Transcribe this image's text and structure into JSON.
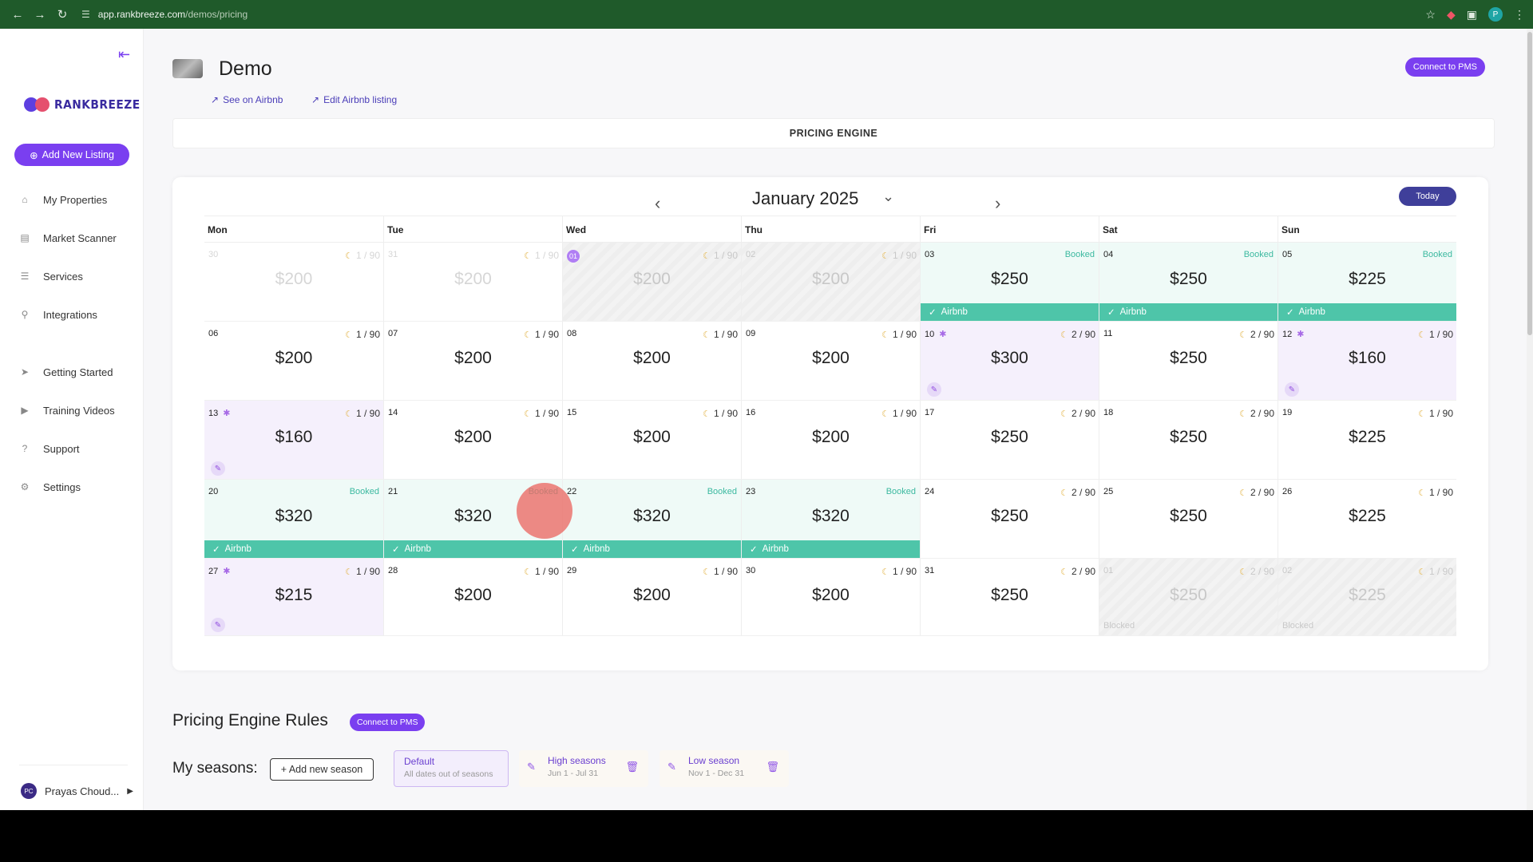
{
  "browser": {
    "url_domain": "app.rankbreeze.com",
    "url_path": "/demos/pricing"
  },
  "sidebar": {
    "brand": "RANKBREEZE",
    "add_listing": "Add New Listing",
    "items": [
      {
        "label": "My Properties",
        "icon": "home-icon"
      },
      {
        "label": "Market Scanner",
        "icon": "map-icon"
      },
      {
        "label": "Services",
        "icon": "list-icon"
      },
      {
        "label": "Integrations",
        "icon": "plug-icon"
      },
      {
        "label": "Getting Started",
        "icon": "rocket-icon"
      },
      {
        "label": "Training Videos",
        "icon": "video-icon"
      },
      {
        "label": "Support",
        "icon": "help-icon"
      },
      {
        "label": "Settings",
        "icon": "gear-icon"
      }
    ],
    "user": {
      "initials": "PC",
      "name": "Prayas Choud..."
    }
  },
  "listing": {
    "title": "Demo",
    "see_on_airbnb": "See on Airbnb",
    "edit_listing": "Edit Airbnb listing",
    "connect_pms": "Connect to PMS"
  },
  "engine_tab": "PRICING ENGINE",
  "calendar": {
    "month": "January 2025",
    "today": "Today",
    "days_of_week": [
      "Mon",
      "Tue",
      "Wed",
      "Thu",
      "Fri",
      "Sat",
      "Sun"
    ],
    "booked_label": "Booked",
    "airbnb_label": "Airbnb",
    "blocked_label": "Blocked",
    "weeks": [
      [
        {
          "day": "30",
          "nights": "1 / 90",
          "price": "$200",
          "style": "outside"
        },
        {
          "day": "31",
          "nights": "1 / 90",
          "price": "$200",
          "style": "outside"
        },
        {
          "day": "01",
          "nights": "1 / 90",
          "price": "$200",
          "style": "faded",
          "today": true
        },
        {
          "day": "02",
          "nights": "1 / 90",
          "price": "$200",
          "style": "faded"
        },
        {
          "day": "03",
          "price": "$250",
          "style": "booked",
          "booked": true,
          "airbnb": true
        },
        {
          "day": "04",
          "price": "$250",
          "style": "booked",
          "booked": true,
          "airbnb": true
        },
        {
          "day": "05",
          "price": "$225",
          "style": "booked",
          "booked": true,
          "airbnb": true
        }
      ],
      [
        {
          "day": "06",
          "nights": "1 / 90",
          "price": "$200"
        },
        {
          "day": "07",
          "nights": "1 / 90",
          "price": "$200"
        },
        {
          "day": "08",
          "nights": "1 / 90",
          "price": "$200"
        },
        {
          "day": "09",
          "nights": "1 / 90",
          "price": "$200"
        },
        {
          "day": "10",
          "nights": "2 / 90",
          "price": "$300",
          "style": "purple",
          "sparkle": true,
          "pin": true
        },
        {
          "day": "11",
          "nights": "2 / 90",
          "price": "$250"
        },
        {
          "day": "12",
          "nights": "1 / 90",
          "price": "$160",
          "style": "purple",
          "sparkle": true,
          "pin": true
        }
      ],
      [
        {
          "day": "13",
          "nights": "1 / 90",
          "price": "$160",
          "style": "purple",
          "sparkle": true,
          "pin": true
        },
        {
          "day": "14",
          "nights": "1 / 90",
          "price": "$200"
        },
        {
          "day": "15",
          "nights": "1 / 90",
          "price": "$200"
        },
        {
          "day": "16",
          "nights": "1 / 90",
          "price": "$200"
        },
        {
          "day": "17",
          "nights": "2 / 90",
          "price": "$250"
        },
        {
          "day": "18",
          "nights": "2 / 90",
          "price": "$250"
        },
        {
          "day": "19",
          "nights": "1 / 90",
          "price": "$225"
        }
      ],
      [
        {
          "day": "20",
          "price": "$320",
          "style": "booked",
          "booked": true,
          "airbnb": true
        },
        {
          "day": "21",
          "price": "$320",
          "style": "booked",
          "booked": true,
          "airbnb": true
        },
        {
          "day": "22",
          "price": "$320",
          "style": "booked",
          "booked": true,
          "airbnb": true
        },
        {
          "day": "23",
          "price": "$320",
          "style": "booked",
          "booked": true,
          "airbnb": true
        },
        {
          "day": "24",
          "nights": "2 / 90",
          "price": "$250"
        },
        {
          "day": "25",
          "nights": "2 / 90",
          "price": "$250"
        },
        {
          "day": "26",
          "nights": "1 / 90",
          "price": "$225"
        }
      ],
      [
        {
          "day": "27",
          "nights": "1 / 90",
          "price": "$215",
          "style": "purple",
          "sparkle": true,
          "pin": true
        },
        {
          "day": "28",
          "nights": "1 / 90",
          "price": "$200"
        },
        {
          "day": "29",
          "nights": "1 / 90",
          "price": "$200"
        },
        {
          "day": "30",
          "nights": "1 / 90",
          "price": "$200"
        },
        {
          "day": "31",
          "nights": "2 / 90",
          "price": "$250"
        },
        {
          "day": "01",
          "nights": "2 / 90",
          "price": "$250",
          "style": "faded",
          "blocked": true
        },
        {
          "day": "02",
          "nights": "1 / 90",
          "price": "$225",
          "style": "faded",
          "blocked": true
        }
      ]
    ]
  },
  "rules": {
    "title": "Pricing Engine Rules",
    "connect_pms": "Connect to PMS",
    "seasons_label": "My seasons:",
    "add_season": "+ Add new season",
    "seasons": [
      {
        "name": "Default",
        "range": "All dates out of seasons"
      },
      {
        "name": "High seasons",
        "range": "Jun 1 - Jul 31"
      },
      {
        "name": "Low season",
        "range": "Nov 1 - Dec 31"
      }
    ]
  },
  "colors": {
    "accent": "#7a3ff0",
    "booked_bar": "#4ec5a9",
    "today_button": "#3f3f9a",
    "browser_bar": "#1f5a2a"
  }
}
